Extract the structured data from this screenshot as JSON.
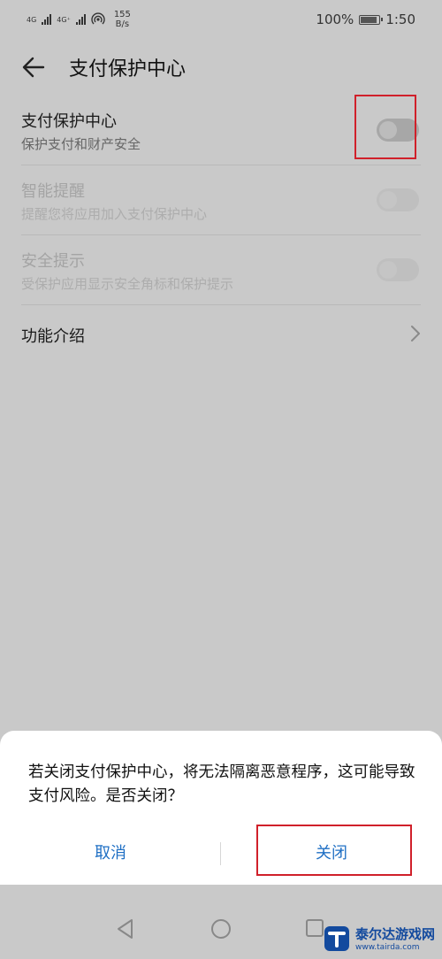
{
  "status_bar": {
    "net1": "4G",
    "net2": "4G⁺",
    "speed_value": "155",
    "speed_unit": "B/s",
    "battery": "100%",
    "time": "1:50"
  },
  "header": {
    "title": "支付保护中心"
  },
  "settings": [
    {
      "title": "支付保护中心",
      "subtitle": "保护支付和财产安全",
      "enabled": false
    },
    {
      "title": "智能提醒",
      "subtitle": "提醒您将应用加入支付保护中心",
      "enabled": false
    },
    {
      "title": "安全提示",
      "subtitle": "受保护应用显示安全角标和保护提示",
      "enabled": false
    }
  ],
  "intro": {
    "label": "功能介绍"
  },
  "dialog": {
    "message": "若关闭支付保护中心，将无法隔离恶意程序，这可能导致支付风险。是否关闭？",
    "cancel_label": "取消",
    "close_label": "关闭"
  },
  "watermark": {
    "brand": "泰尔达游戏网",
    "url": "www.tairda.com"
  },
  "colors": {
    "accent": "#1f6fc4",
    "highlight": "#d0202a"
  },
  "icons": [
    "back-arrow-icon",
    "chevron-right-icon",
    "nav-back-icon",
    "nav-home-icon",
    "nav-recent-icon",
    "hotspot-icon",
    "battery-icon"
  ]
}
